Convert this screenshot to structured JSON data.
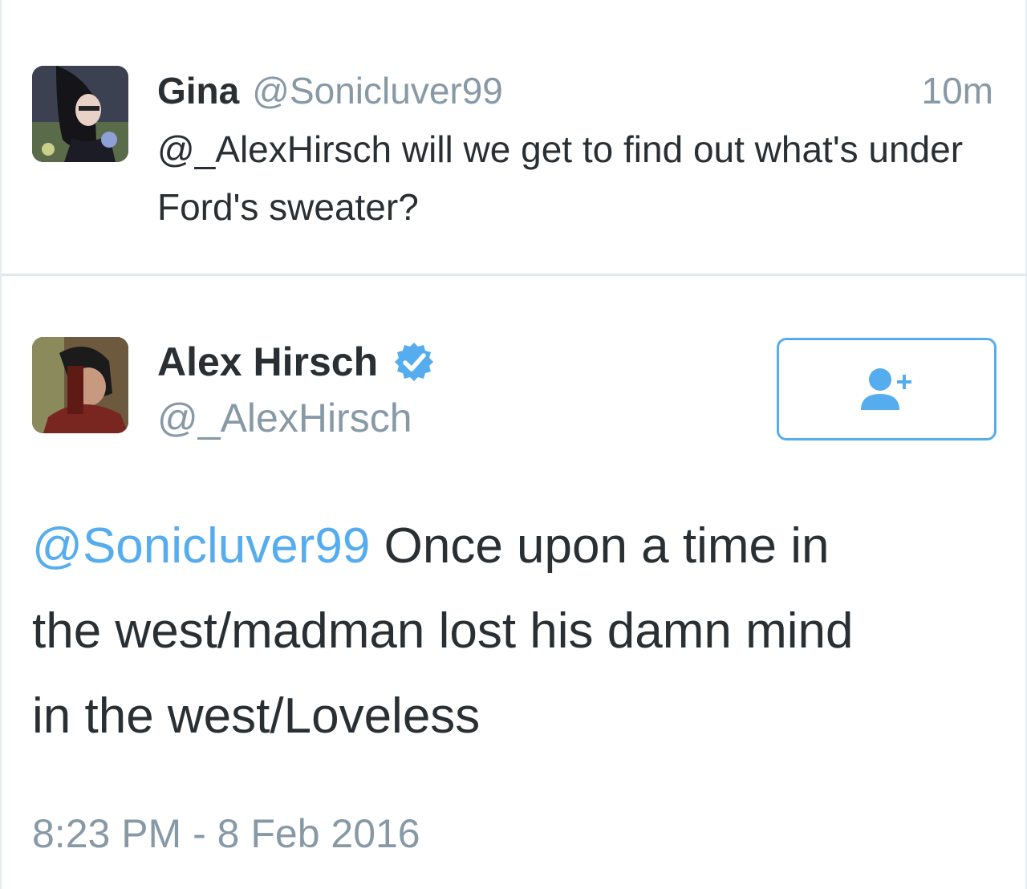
{
  "reply_context": {
    "name": "Gina",
    "handle": "@Sonicluver99",
    "time": "10m",
    "text": "@_AlexHirsch will we get to find out what's under Ford's sweater?",
    "avatar_icon": "user-avatar-anime-character"
  },
  "tweet": {
    "name": "Alex Hirsch",
    "verified_icon": "verified-badge-icon",
    "handle": "@_AlexHirsch",
    "follow_icon": "follow-user-plus-icon",
    "mention": "@Sonicluver99",
    "text_line_1": " Once upon a time in",
    "text_line_2": "the west/madman lost his damn mind",
    "text_line_3": "in the west/Loveless",
    "timestamp": "8:23 PM - 8 Feb 2016",
    "avatar_icon": "user-avatar-photo"
  },
  "colors": {
    "accent": "#55acee",
    "text": "#292f33",
    "muted": "#8899a6",
    "divider": "#e1e8ed"
  }
}
